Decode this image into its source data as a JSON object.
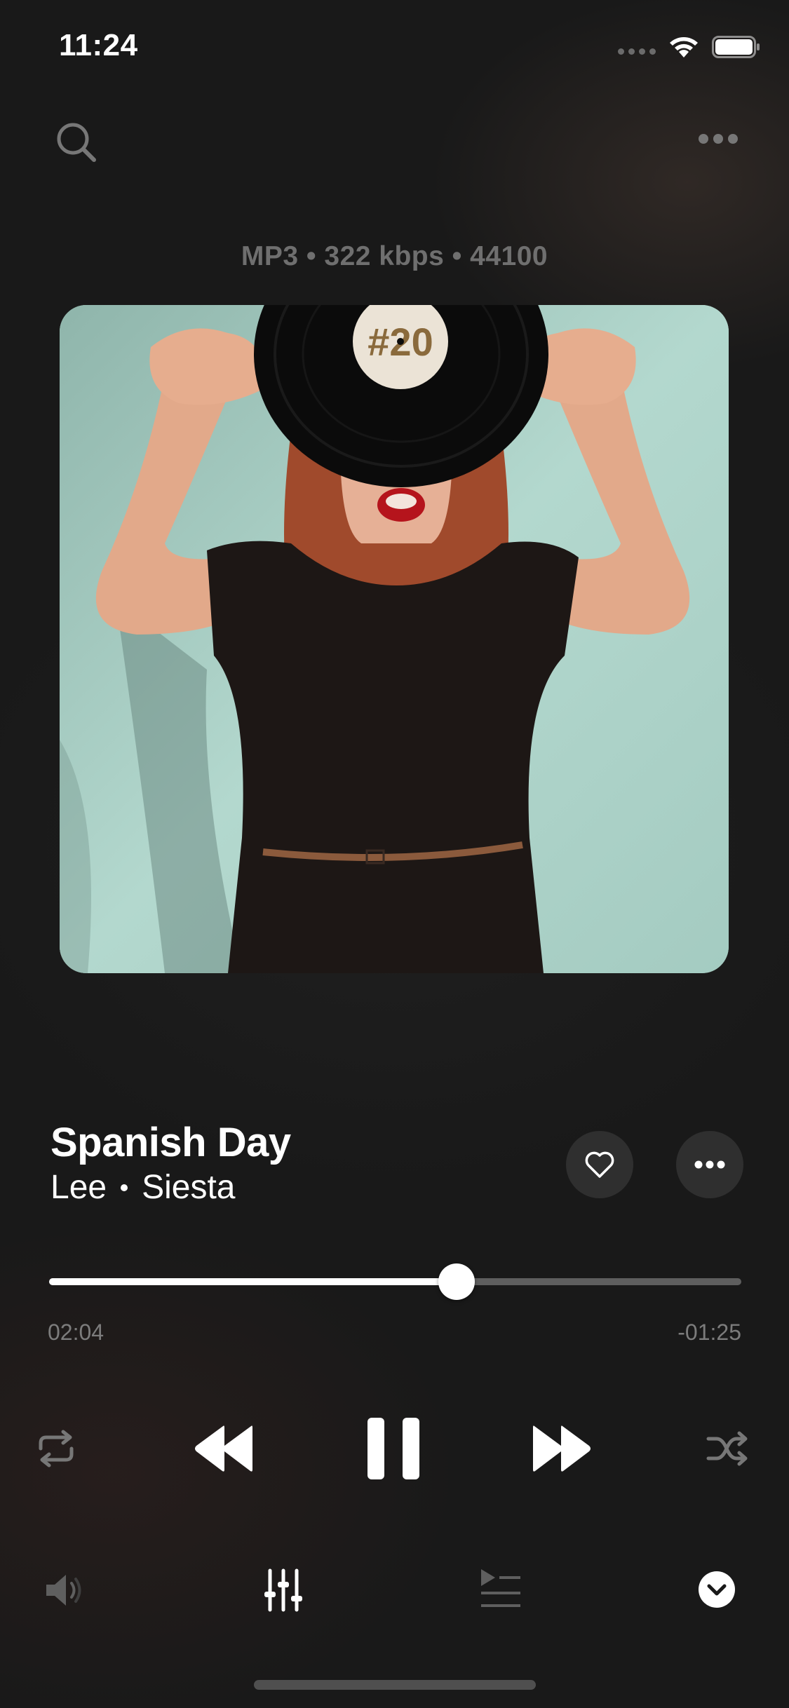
{
  "status_bar": {
    "time": "11:24",
    "icons": [
      "signal-dots-icon",
      "wifi-icon",
      "battery-icon"
    ]
  },
  "top_bar": {
    "icons": [
      "search-icon",
      "more-horizontal-icon"
    ]
  },
  "audio_format": "MP3 • 322 kbps • 44100",
  "artwork": {
    "icon": "album-artwork-photo",
    "record_label_text": "#20"
  },
  "track": {
    "title": "Spanish Day",
    "artist": "Lee",
    "album": "Siesta",
    "liked": false
  },
  "playback": {
    "progress_fraction": 0.589,
    "elapsed": "02:04",
    "remaining": "-01:25",
    "is_playing": true
  },
  "controls": {
    "icons": [
      "repeat-icon",
      "rewind-icon",
      "pause-icon",
      "fast-forward-icon",
      "shuffle-icon"
    ]
  },
  "bottom_bar": {
    "icons": [
      "volume-icon",
      "equalizer-icon",
      "queue-icon",
      "chevron-down-icon"
    ]
  },
  "colors": {
    "background": "#191919",
    "accent": "#ffffff",
    "muted_text": "#7c7c7c",
    "button_bg": "#2f2f2f"
  }
}
